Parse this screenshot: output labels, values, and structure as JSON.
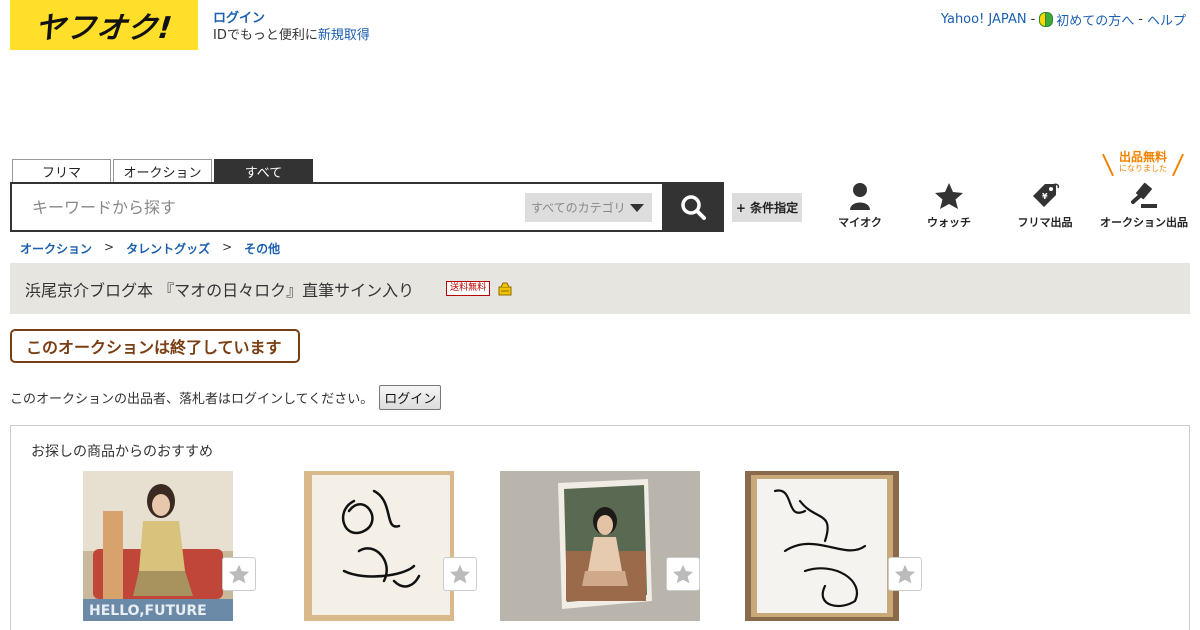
{
  "header": {
    "logo_text": "ヤフオク!",
    "login_label": "ログイン",
    "login_line_prefix": "IDでもっと便利に",
    "signup_label": "新規取得",
    "yahoo_japan": "Yahoo! JAPAN",
    "separator": "-",
    "beginner_label": "初めての方へ",
    "help_label": "ヘルプ"
  },
  "tabs": [
    {
      "label": "フリマ"
    },
    {
      "label": "オークション"
    },
    {
      "label": "すべて"
    }
  ],
  "search": {
    "placeholder": "キーワードから探す",
    "category_label": "すべてのカテゴリ",
    "condition_label": "+ 条件指定"
  },
  "nav": {
    "myauc": "マイオク",
    "watch": "ウォッチ",
    "flea_listing": "フリマ出品",
    "auction_listing": "オークション出品",
    "free_badge_main": "出品無料",
    "free_badge_sub": "になりました"
  },
  "breadcrumb": {
    "items": [
      "オークション",
      "タレントグッズ",
      "その他"
    ],
    "separator": ">"
  },
  "item": {
    "title": "浜尾京介ブログ本 『マオの日々ロク』直筆サイン入り",
    "shipping_badge": "送料無料"
  },
  "status": {
    "ended_message": "このオークションは終了しています",
    "login_notice": "このオークションの出品者、落札者はログインしてください。",
    "login_button": "ログイン"
  },
  "recommend": {
    "title": "お探しの商品からのおすすめ",
    "photo_caption_1": "HELLO,FUTURE"
  },
  "colors": {
    "accent_yellow": "#ffdf2a",
    "link_blue": "#1c5fb0",
    "ended_brown": "#7a3e13",
    "free_orange": "#f08300"
  }
}
